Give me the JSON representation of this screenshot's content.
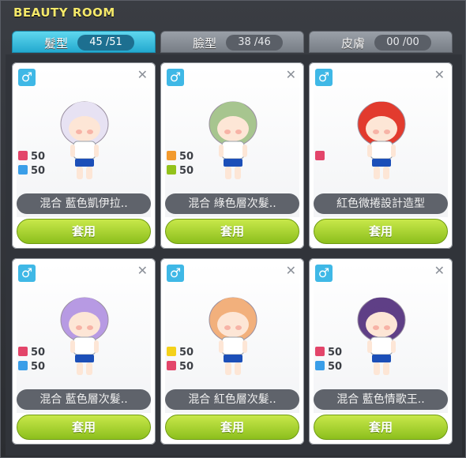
{
  "window": {
    "title": "BEAUTY ROOM"
  },
  "tabs": [
    {
      "label": "髮型",
      "count": "45 /51",
      "active": true
    },
    {
      "label": "臉型",
      "count": "38 /46",
      "active": false
    },
    {
      "label": "皮膚",
      "count": "00 /00",
      "active": false
    }
  ],
  "cards": [
    {
      "name": "混合  藍色凱伊拉..",
      "hair_color": "#e7e2f3",
      "stats": [
        {
          "color": "#e3456a",
          "value": "50"
        },
        {
          "color": "#3a9ee8",
          "value": "50"
        }
      ],
      "apply_label": "套用"
    },
    {
      "name": "混合  綠色層次髮..",
      "hair_color": "#a7c58f",
      "stats": [
        {
          "color": "#f29a2e",
          "value": "50"
        },
        {
          "color": "#93c21b",
          "value": "50"
        }
      ],
      "apply_label": "套用"
    },
    {
      "name": "紅色微捲設計造型",
      "hair_color": "#e23b2e",
      "stats": [
        {
          "color": "#e3456a",
          "value": ""
        }
      ],
      "apply_label": "套用"
    },
    {
      "name": "混合  藍色層次髮..",
      "hair_color": "#b79ae3",
      "stats": [
        {
          "color": "#e3456a",
          "value": "50"
        },
        {
          "color": "#3a9ee8",
          "value": "50"
        }
      ],
      "apply_label": "套用"
    },
    {
      "name": "混合  紅色層次髮..",
      "hair_color": "#f2b07c",
      "stats": [
        {
          "color": "#f4d11a",
          "value": "50"
        },
        {
          "color": "#e3456a",
          "value": "50"
        }
      ],
      "apply_label": "套用"
    },
    {
      "name": "混合  藍色情歌王..",
      "hair_color": "#5f3f86",
      "stats": [
        {
          "color": "#e3456a",
          "value": "50"
        },
        {
          "color": "#3a9ee8",
          "value": "50"
        }
      ],
      "apply_label": "套用"
    }
  ],
  "icons": {
    "gender": "male-icon",
    "close": "close-icon"
  }
}
